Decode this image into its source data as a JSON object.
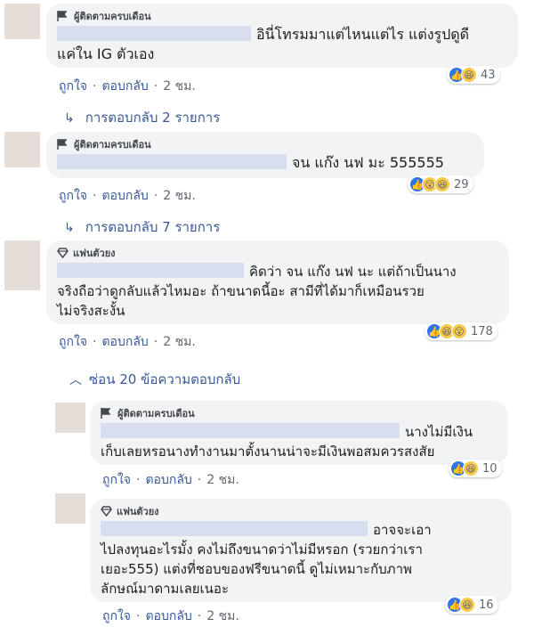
{
  "comments": [
    {
      "badge": "ผู้ติดตามครบเดือน",
      "badge_icon": "flag-icon",
      "text": "อินี่โทรมมาแต่ไหนแต่ไร แต่งรูปดูดี\nแค่ใน IG ตัวเอง",
      "actions": {
        "like": "ถูกใจ",
        "reply": "ตอบกลับ",
        "time": "2 ชม."
      },
      "reactions": {
        "types": [
          "like",
          "haha"
        ],
        "count": "43"
      }
    },
    {
      "badge": "ผู้ติดตามครบเดือน",
      "badge_icon": "flag-icon",
      "text": "จน แก๊ง นฟ มะ 555555",
      "actions": {
        "like": "ถูกใจ",
        "reply": "ตอบกลับ",
        "time": "2 ชม."
      },
      "reactions": {
        "types": [
          "like",
          "wow",
          "haha"
        ],
        "count": "29"
      }
    },
    {
      "badge": "แฟนตัวยง",
      "badge_icon": "diamond-icon",
      "text": "คิดว่า จน แก๊ง นฟ นะ แต่ถ้าเป็นนาง\nจริงถือว่าดูกลับแล้วไหมอะ ถ้าขนาดนี้อะ สามีที่ได้มาก็เหมือนรวย\nไม่จริงสะงั้น",
      "actions": {
        "like": "ถูกใจ",
        "reply": "ตอบกลับ",
        "time": "2 ชม."
      },
      "reactions": {
        "types": [
          "like",
          "haha",
          "wow"
        ],
        "count": "178"
      }
    }
  ],
  "reply_links": [
    "การตอบกลับ 2 รายการ",
    "การตอบกลับ 7 รายการ"
  ],
  "hide_replies": "ซ่อน 20 ข้อความตอบกลับ",
  "replies": [
    {
      "badge": "ผู้ติดตามครบเดือน",
      "badge_icon": "flag-icon",
      "text": "นางไม่มีเงิน\nเก็บเลยหรอนางทำงานมาตั้งนานน่าจะมีเงินพอสมควรสงสัย",
      "actions": {
        "like": "ถูกใจ",
        "reply": "ตอบกลับ",
        "time": "2 ชม."
      },
      "reactions": {
        "types": [
          "like",
          "haha"
        ],
        "count": "10"
      }
    },
    {
      "badge": "แฟนตัวยง",
      "badge_icon": "diamond-icon",
      "text": "อาจจะเอา\nไปลงทุนอะไรมั้ง คงไม่ถึงขนาดว่าไม่มีหรอก (รวยกว่าเรา\nเยอะ555) แต่งที่ชอบของฟรีขนาดนี้ ดูไม่เหมาะกับภาพ\nลักษณ์มาดามเลยเนอะ",
      "actions": {
        "like": "ถูกใจ",
        "reply": "ตอบกลับ",
        "time": "2 ชม."
      },
      "reactions": {
        "types": [
          "like",
          "haha"
        ],
        "count": "16"
      }
    }
  ],
  "colors": {
    "link": "#385898",
    "bubble": "#f2f3f5",
    "like": "#2e74ec",
    "emoji": "#f7c94a"
  }
}
